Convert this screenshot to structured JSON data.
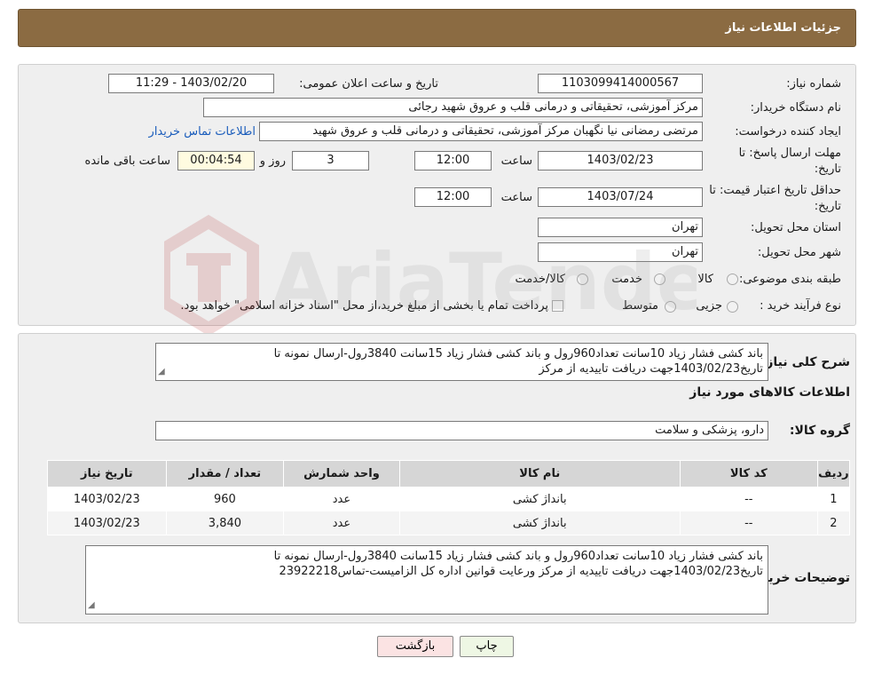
{
  "header": {
    "title": "جزئیات اطلاعات نیاز"
  },
  "form": {
    "need_number_label": "شماره نیاز:",
    "need_number": "1103099414000567",
    "announce_label": "تاریخ و ساعت اعلان عمومی:",
    "announce_value": "1403/02/20 - 11:29",
    "buyer_org_label": "نام دستگاه خریدار:",
    "buyer_org": "مرکز آموزشی، تحقیقاتی و درمانی قلب و عروق شهید رجائی",
    "requester_label": "ایجاد کننده درخواست:",
    "requester": "مرتضی رمضانی نیا نگهبان مرکز آموزشی، تحقیقاتی و درمانی قلب و عروق شهید",
    "contact_link": "اطلاعات تماس خریدار",
    "deadline_label_1": "مهلت ارسال پاسخ: تا",
    "deadline_label_2": "تاریخ:",
    "deadline_date": "1403/02/23",
    "time_label": "ساعت",
    "deadline_time": "12:00",
    "days_value": "3",
    "days_label": "روز و",
    "remaining_time": "00:04:54",
    "remaining_label": "ساعت باقی مانده",
    "price_validity_label_1": "حداقل تاریخ اعتبار قیمت: تا",
    "price_validity_label_2": "تاریخ:",
    "price_validity_date": "1403/07/24",
    "price_validity_time": "12:00",
    "province_label": "استان محل تحویل:",
    "province": "تهران",
    "city_label": "شهر محل تحویل:",
    "city": "تهران",
    "category_label": "طبقه بندی موضوعی:",
    "category_options": [
      "کالا",
      "خدمت",
      "کالا/خدمت"
    ],
    "process_label": "نوع فرآیند خرید :",
    "process_options": [
      "جزیی",
      "متوسط"
    ],
    "process_note": "پرداخت تمام یا بخشی از مبلغ خرید،از محل \"اسناد خزانه اسلامی\" خواهد بود."
  },
  "details": {
    "summary_label": "شرح کلی نیاز:",
    "summary_line1": "باند کشی فشار زیاد 10سانت تعداد960رول و باند کشی  فشار زیاد 15سانت 3840رول-ارسال نمونه تا",
    "summary_line2": "تاریخ1403/02/23جهت دریافت تاییدیه از مرکز",
    "goods_info_title": "اطلاعات کالاهای مورد نیاز",
    "goods_group_label": "گروه کالا:",
    "goods_group": "دارو، پزشکی و سلامت",
    "table": {
      "headers": [
        "ردیف",
        "کد کالا",
        "نام کالا",
        "واحد شمارش",
        "تعداد / مقدار",
        "تاریخ نیاز"
      ],
      "rows": [
        [
          "1",
          "--",
          "بانداژ کشی",
          "عدد",
          "960",
          "1403/02/23"
        ],
        [
          "2",
          "--",
          "بانداژ کشی",
          "عدد",
          "3,840",
          "1403/02/23"
        ]
      ]
    },
    "buyer_notes_label": "توضیحات خریدار:",
    "buyer_notes_line1": "باند کشی فشار زیاد 10سانت تعداد960رول و باند کشی  فشار زیاد 15سانت 3840رول-ارسال نمونه تا",
    "buyer_notes_line2": "تاریخ1403/02/23جهت دریافت تاییدیه از مرکز ورعایت قوانین اداره کل الزامیست-تماس23922218"
  },
  "buttons": {
    "print": "چاپ",
    "back": "بازگشت"
  },
  "colors": {
    "header_bg": "#8b6b42",
    "link": "#1a5cbb",
    "back_button_bg": "#fbe3e3",
    "print_button_bg": "#eef7e4"
  }
}
